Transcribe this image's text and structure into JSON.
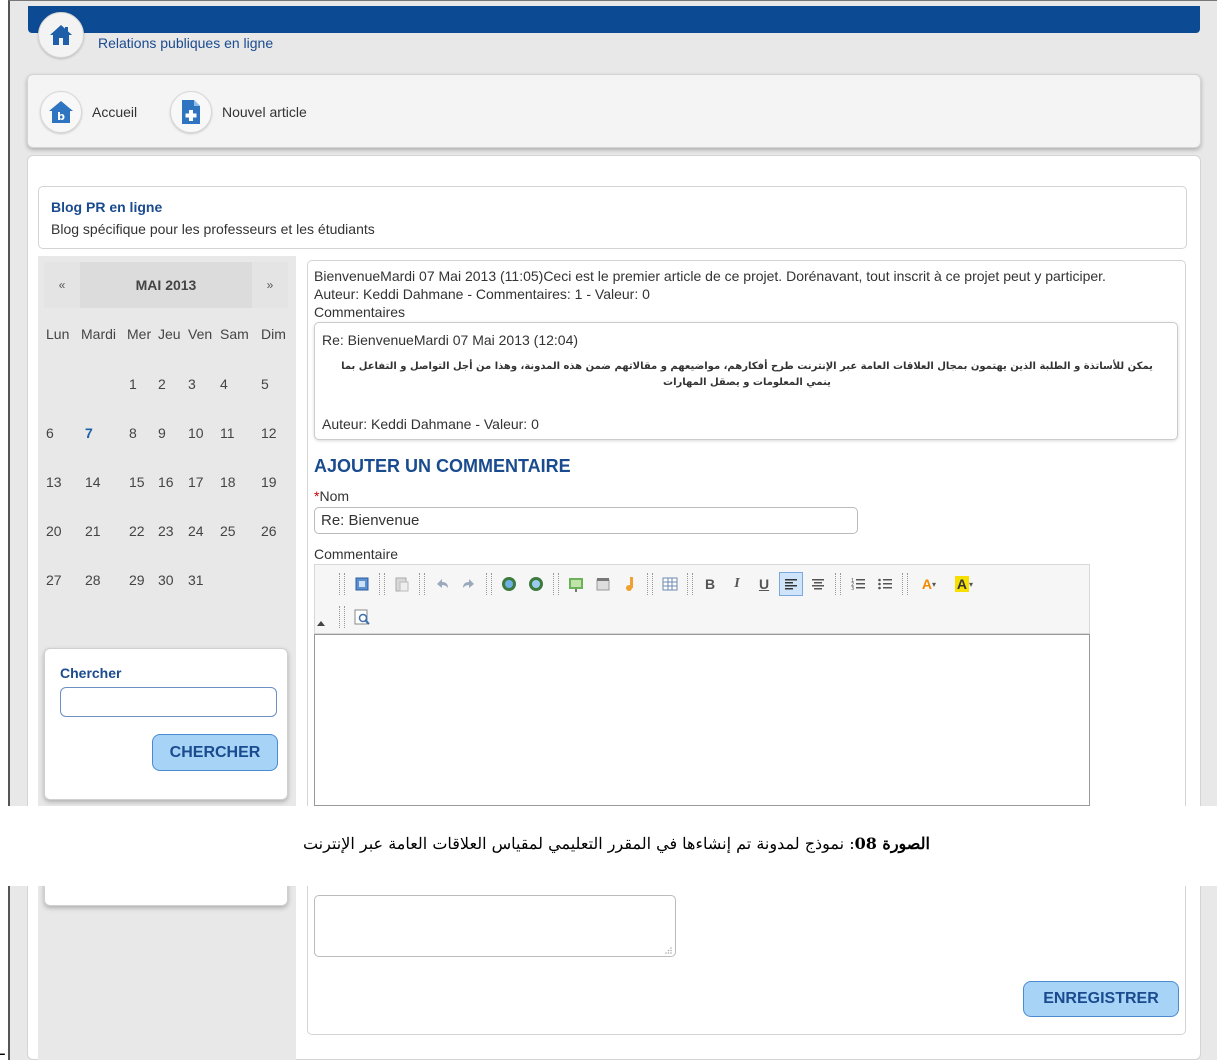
{
  "header": {
    "site_title": "Relations publiques en ligne"
  },
  "nav": {
    "items": [
      {
        "label": "Accueil",
        "icon": "home-icon"
      },
      {
        "label": "Nouvel article",
        "icon": "new-document-icon"
      }
    ]
  },
  "blog": {
    "title": "Blog PR en ligne",
    "description": "Blog spécifique pour les professeurs et les étudiants"
  },
  "calendar": {
    "prev": "«",
    "next": "»",
    "month": "MAI 2013",
    "day_names": [
      "Lun",
      "Mardi",
      "Mer",
      "Jeu",
      "Ven",
      "Sam",
      "Dim"
    ],
    "weeks": [
      [
        "",
        "",
        "1",
        "2",
        "3",
        "4",
        "5"
      ],
      [
        "6",
        "7",
        "8",
        "9",
        "10",
        "11",
        "12"
      ],
      [
        "13",
        "14",
        "15",
        "16",
        "17",
        "18",
        "19"
      ],
      [
        "20",
        "21",
        "22",
        "23",
        "24",
        "25",
        "26"
      ],
      [
        "27",
        "28",
        "29",
        "30",
        "31",
        "",
        ""
      ]
    ],
    "linked_day": "7"
  },
  "search": {
    "label": "Chercher",
    "button": "CHERCHER"
  },
  "post": {
    "line1": "BienvenueMardi 07 Mai 2013 (11:05)Ceci est le premier article de ce projet. Dorénavant, tout inscrit à ce projet peut y participer.",
    "line2": "Auteur: Keddi Dahmane - Commentaires: 1 - Valeur: 0",
    "comments_heading": "Commentaires"
  },
  "comment": {
    "title": "Re: BienvenueMardi 07 Mai 2013 (12:04)",
    "body": "يمكن للأساتذة و الطلبة الذين يهتمون بمجال العلاقات العامة عبر الإنترنت طرح أفكارهم، مواضيعهم و مقالاتهم ضمن هذه المدونة، وهذا من أجل التواصل و التفاعل بما ينمي المعلومات و يصقل المهارات",
    "author": "Auteur: Keddi Dahmane - Valeur: 0"
  },
  "add_comment": {
    "heading": "AJOUTER UN COMMENTAIRE",
    "required_mark": "*",
    "name_label": "Nom",
    "name_value": "Re: Bienvenue",
    "comment_label": "Commentaire",
    "save_button": "ENREGISTRER"
  },
  "caption": {
    "bold": "الصورة 08",
    "text": ": نموذج لمدونة تم إنشاءها في المقرر التعليمي لمقياس العلاقات العامة عبر الإنترنت"
  },
  "bottom_mark": "ـ",
  "colors": {
    "brand_blue": "#0d4a94",
    "link_blue": "#1a4b8f",
    "button_fill": "#a7d3f7"
  }
}
